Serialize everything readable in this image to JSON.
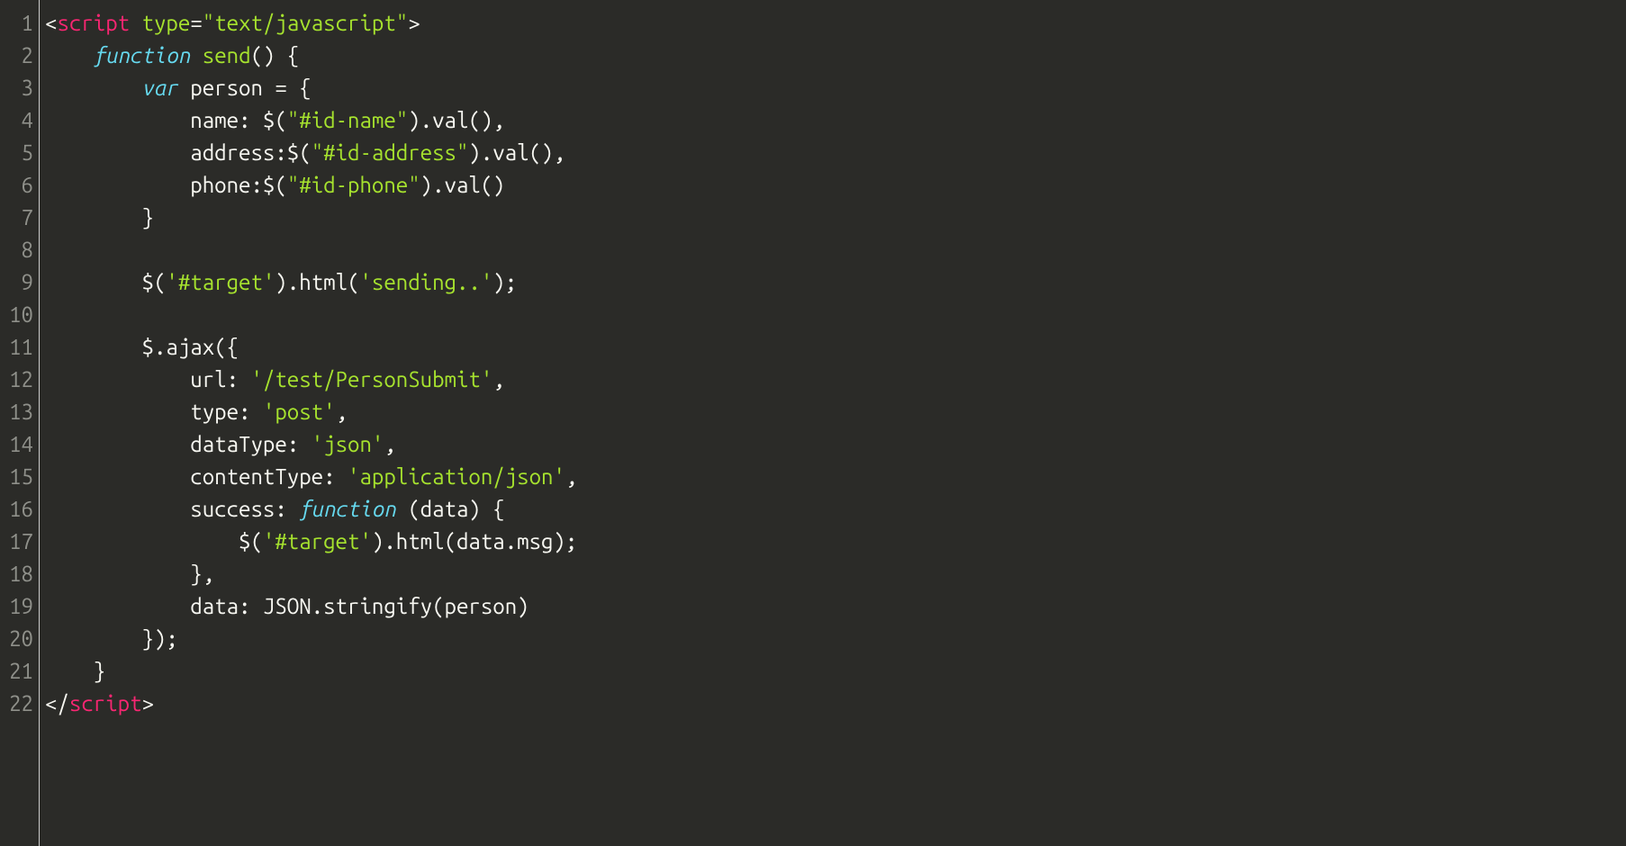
{
  "lineCount": 22,
  "code": {
    "lines": [
      [
        {
          "cls": "tok-punct",
          "t": "<"
        },
        {
          "cls": "tok-tag",
          "t": "script"
        },
        {
          "cls": "tok-ident",
          "t": " "
        },
        {
          "cls": "tok-attr",
          "t": "type"
        },
        {
          "cls": "tok-punct",
          "t": "="
        },
        {
          "cls": "tok-string",
          "t": "\"text/javascript\""
        },
        {
          "cls": "tok-punct",
          "t": ">"
        }
      ],
      [
        {
          "cls": "tok-ident",
          "t": "    "
        },
        {
          "cls": "tok-keyword",
          "t": "function"
        },
        {
          "cls": "tok-ident",
          "t": " "
        },
        {
          "cls": "tok-name",
          "t": "send"
        },
        {
          "cls": "tok-punct",
          "t": "() {"
        }
      ],
      [
        {
          "cls": "tok-ident",
          "t": "        "
        },
        {
          "cls": "tok-keyword",
          "t": "var"
        },
        {
          "cls": "tok-ident",
          "t": " person "
        },
        {
          "cls": "tok-punct",
          "t": "= {"
        }
      ],
      [
        {
          "cls": "tok-ident",
          "t": "            name: $("
        },
        {
          "cls": "tok-string",
          "t": "\"#id-name\""
        },
        {
          "cls": "tok-ident",
          "t": ").val(),"
        }
      ],
      [
        {
          "cls": "tok-ident",
          "t": "            address:$("
        },
        {
          "cls": "tok-string",
          "t": "\"#id-address\""
        },
        {
          "cls": "tok-ident",
          "t": ").val(),"
        }
      ],
      [
        {
          "cls": "tok-ident",
          "t": "            phone:$("
        },
        {
          "cls": "tok-string",
          "t": "\"#id-phone\""
        },
        {
          "cls": "tok-ident",
          "t": ").val()"
        }
      ],
      [
        {
          "cls": "tok-ident",
          "t": "        }"
        }
      ],
      [
        {
          "cls": "tok-ident",
          "t": ""
        }
      ],
      [
        {
          "cls": "tok-ident",
          "t": "        $("
        },
        {
          "cls": "tok-string",
          "t": "'#target'"
        },
        {
          "cls": "tok-ident",
          "t": ").html("
        },
        {
          "cls": "tok-string",
          "t": "'sending..'"
        },
        {
          "cls": "tok-ident",
          "t": ");"
        }
      ],
      [
        {
          "cls": "tok-ident",
          "t": ""
        }
      ],
      [
        {
          "cls": "tok-ident",
          "t": "        $.ajax({"
        }
      ],
      [
        {
          "cls": "tok-ident",
          "t": "            url: "
        },
        {
          "cls": "tok-string",
          "t": "'/test/PersonSubmit'"
        },
        {
          "cls": "tok-ident",
          "t": ","
        }
      ],
      [
        {
          "cls": "tok-ident",
          "t": "            type: "
        },
        {
          "cls": "tok-string",
          "t": "'post'"
        },
        {
          "cls": "tok-ident",
          "t": ","
        }
      ],
      [
        {
          "cls": "tok-ident",
          "t": "            dataType: "
        },
        {
          "cls": "tok-string",
          "t": "'json'"
        },
        {
          "cls": "tok-ident",
          "t": ","
        }
      ],
      [
        {
          "cls": "tok-ident",
          "t": "            contentType: "
        },
        {
          "cls": "tok-string",
          "t": "'application/json'"
        },
        {
          "cls": "tok-ident",
          "t": ","
        }
      ],
      [
        {
          "cls": "tok-ident",
          "t": "            success: "
        },
        {
          "cls": "tok-keyword",
          "t": "function"
        },
        {
          "cls": "tok-ident",
          "t": " (data) {"
        }
      ],
      [
        {
          "cls": "tok-ident",
          "t": "                $("
        },
        {
          "cls": "tok-string",
          "t": "'#target'"
        },
        {
          "cls": "tok-ident",
          "t": ").html(data.msg);"
        }
      ],
      [
        {
          "cls": "tok-ident",
          "t": "            },"
        }
      ],
      [
        {
          "cls": "tok-ident",
          "t": "            data: JSON.stringify(person)"
        }
      ],
      [
        {
          "cls": "tok-ident",
          "t": "        });"
        }
      ],
      [
        {
          "cls": "tok-ident",
          "t": "    }"
        }
      ],
      [
        {
          "cls": "tok-punct",
          "t": "</"
        },
        {
          "cls": "tok-tag",
          "t": "script"
        },
        {
          "cls": "tok-punct",
          "t": ">"
        }
      ]
    ]
  }
}
